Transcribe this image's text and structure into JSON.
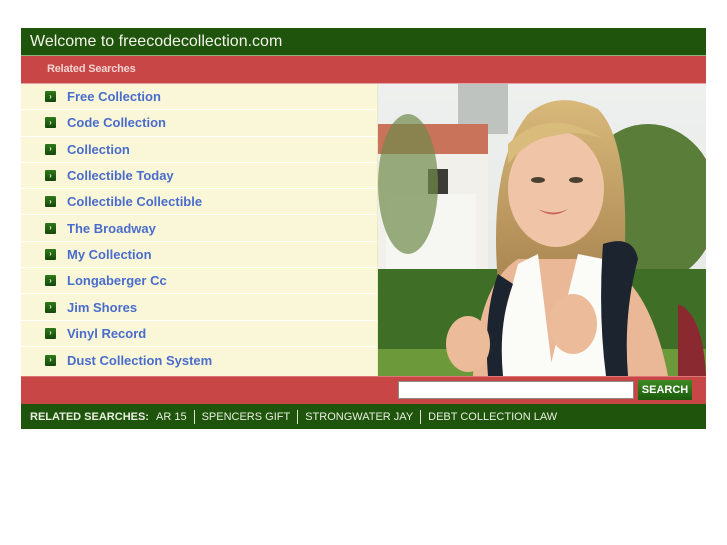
{
  "header": {
    "title": "Welcome to freecodecollection.com"
  },
  "related_bar": {
    "label": "Related Searches"
  },
  "list": {
    "items": [
      {
        "label": "Free Collection"
      },
      {
        "label": "Code Collection"
      },
      {
        "label": "Collection"
      },
      {
        "label": "Collectible Today"
      },
      {
        "label": "Collectible Collectible"
      },
      {
        "label": "The Broadway"
      },
      {
        "label": "My Collection"
      },
      {
        "label": "Longaberger Cc"
      },
      {
        "label": "Jim Shores"
      },
      {
        "label": "Vinyl Record"
      },
      {
        "label": "Dust Collection System"
      }
    ],
    "bullet_icon": "arrow-right-icon",
    "bullet_glyph": "›"
  },
  "search": {
    "value": "",
    "placeholder": "",
    "button_label": "SEARCH"
  },
  "footer": {
    "label": "RELATED SEARCHES:",
    "links": [
      {
        "label": "AR 15"
      },
      {
        "label": "SPENCERS GIFT"
      },
      {
        "label": "STRONGWATER JAY"
      },
      {
        "label": "DEBT COLLECTION LAW"
      }
    ]
  },
  "colors": {
    "header_green": "#1e540c",
    "accent_red": "#c84646",
    "list_bg": "#f9f7d7",
    "link_blue": "#4a6ccc"
  }
}
